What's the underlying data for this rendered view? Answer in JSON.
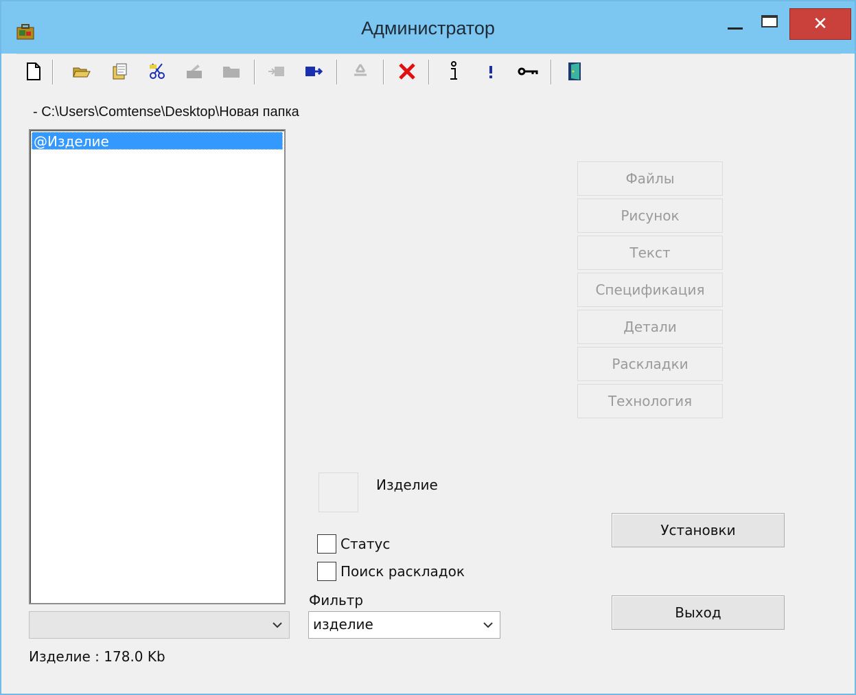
{
  "window": {
    "title": "Администратор",
    "close_glyph": "✕"
  },
  "toolbar": {
    "icons": [
      "new-document-icon",
      "open-folder-icon",
      "copy-folder-icon",
      "cut-icon",
      "paste-icon",
      "folder-icon",
      "move-left-icon",
      "move-right-icon",
      "recycle-icon",
      "delete-icon",
      "info-icon",
      "exclamation-icon",
      "key-icon",
      "exit-door-icon"
    ]
  },
  "path": "- C:\\Users\\Comtense\\Desktop\\Новая папка",
  "list": {
    "items": [
      "@Изделие"
    ],
    "selected_index": 0
  },
  "left_combo": {
    "value": ""
  },
  "size_label": "Изделие :  178.0 Kb",
  "side_buttons": [
    "Файлы",
    "Рисунок",
    "Текст",
    "Спецификация",
    "Детали",
    "Раскладки",
    "Технология"
  ],
  "item_name": "Изделие",
  "checkboxes": [
    {
      "label": "Статус",
      "checked": false
    },
    {
      "label": "Поиск раскладок",
      "checked": false
    }
  ],
  "filter": {
    "label": "Фильтр",
    "value": "изделие"
  },
  "buttons": {
    "settings": "Установки",
    "exit": "Выход"
  },
  "colors": {
    "titlebar": "#7cc6f2",
    "selection": "#3399ff",
    "close": "#c9413a"
  }
}
